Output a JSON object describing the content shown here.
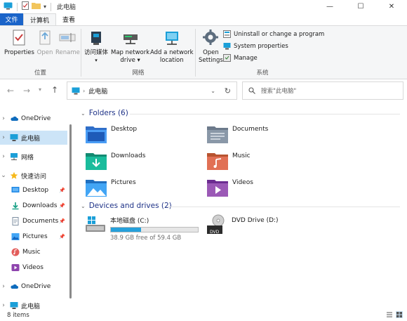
{
  "window": {
    "title": "此电脑",
    "minimize": "—",
    "maximize": "☐",
    "close": "✕"
  },
  "tabs": [
    {
      "label": "文件"
    },
    {
      "label": "计算机"
    },
    {
      "label": "查看"
    }
  ],
  "ribbon": {
    "location": {
      "group_label": "位置",
      "properties": "Properties",
      "open": "Open",
      "rename": "Rename"
    },
    "network": {
      "group_label": "网络",
      "access_media": "访问媒体",
      "map_network_drive_1": "Map network",
      "map_network_drive_2": "drive",
      "add_network_location_1": "Add a network",
      "add_network_location_2": "location"
    },
    "system": {
      "group_label": "系统",
      "open_settings_1": "Open",
      "open_settings_2": "Settings",
      "uninstall": "Uninstall or change a program",
      "system_properties": "System properties",
      "manage": "Manage"
    }
  },
  "address": {
    "path": "此电脑",
    "search_placeholder": "搜索\"此电脑\""
  },
  "nav": {
    "onedrive_top": "OneDrive",
    "this_pc": "此电脑",
    "network": "网络",
    "quick_access": "快速访问",
    "desktop": "Desktop",
    "downloads": "Downloads",
    "documents": "Documents",
    "pictures": "Pictures",
    "music": "Music",
    "videos": "Videos",
    "onedrive_bottom": "OneDrive",
    "this_pc_bottom": "此电脑"
  },
  "folders_section": {
    "header": "Folders (6)",
    "items": [
      {
        "label": "Desktop"
      },
      {
        "label": "Documents"
      },
      {
        "label": "Downloads"
      },
      {
        "label": "Music"
      },
      {
        "label": "Pictures"
      },
      {
        "label": "Videos"
      }
    ]
  },
  "drives_section": {
    "header": "Devices and drives (2)",
    "local_disk": {
      "label": "本地磁盘 (C:)",
      "free_text": "38.9 GB free of 59.4 GB",
      "used_fraction": 0.345
    },
    "dvd": {
      "label": "DVD Drive (D:)",
      "badge": "DVD"
    }
  },
  "status": {
    "items_count": "8 items"
  },
  "colors": {
    "accent": "#1a64c9",
    "section_header": "#1e3287",
    "selected_nav": "#cce4f7",
    "drive_fill": "#26a0da"
  }
}
